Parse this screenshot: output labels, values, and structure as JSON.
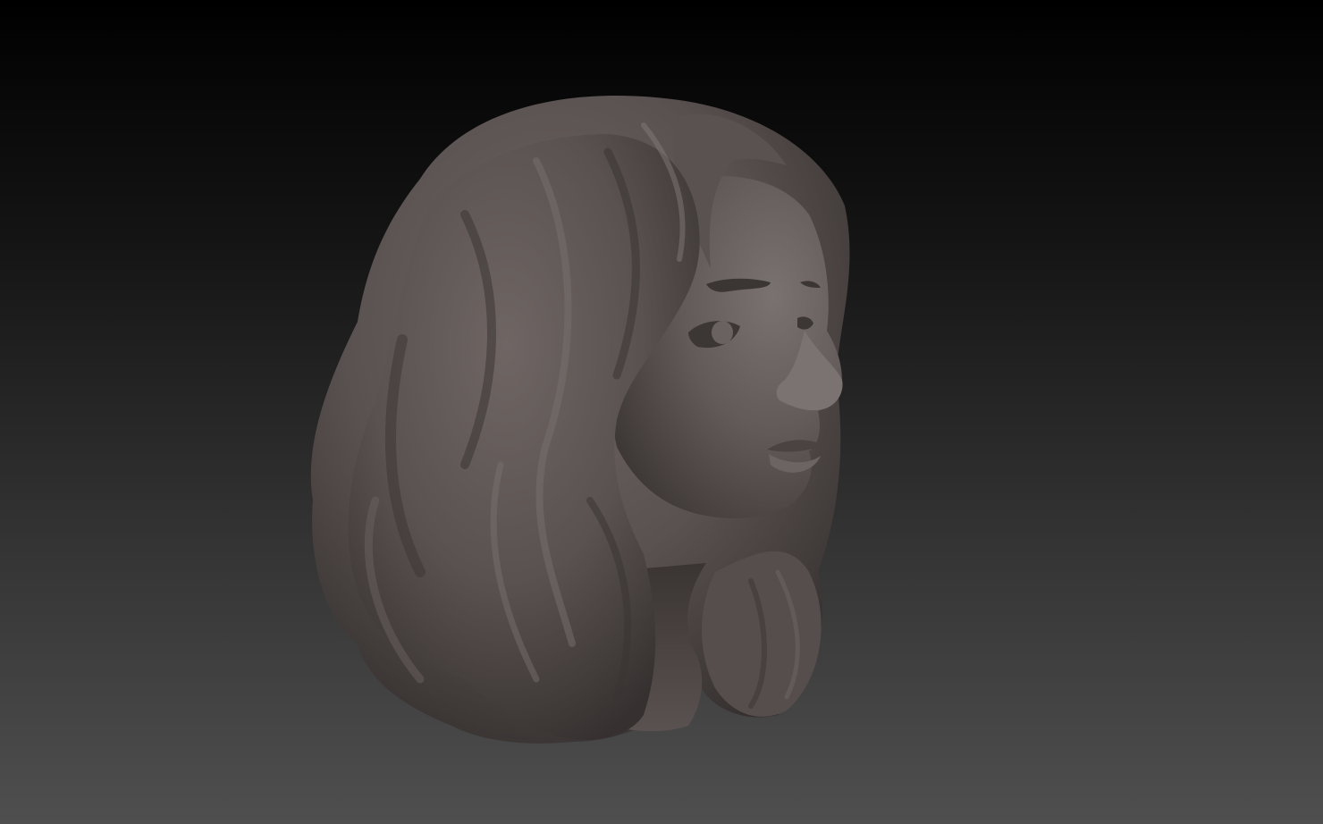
{
  "viewport": {
    "background_top": "#000000",
    "background_bottom": "#4f4f4f"
  },
  "model": {
    "description_icon": "sculpted-head-icon",
    "material_color": "#5e5654",
    "highlight_color": "#8a8280",
    "shadow_color": "#2e2a29"
  }
}
